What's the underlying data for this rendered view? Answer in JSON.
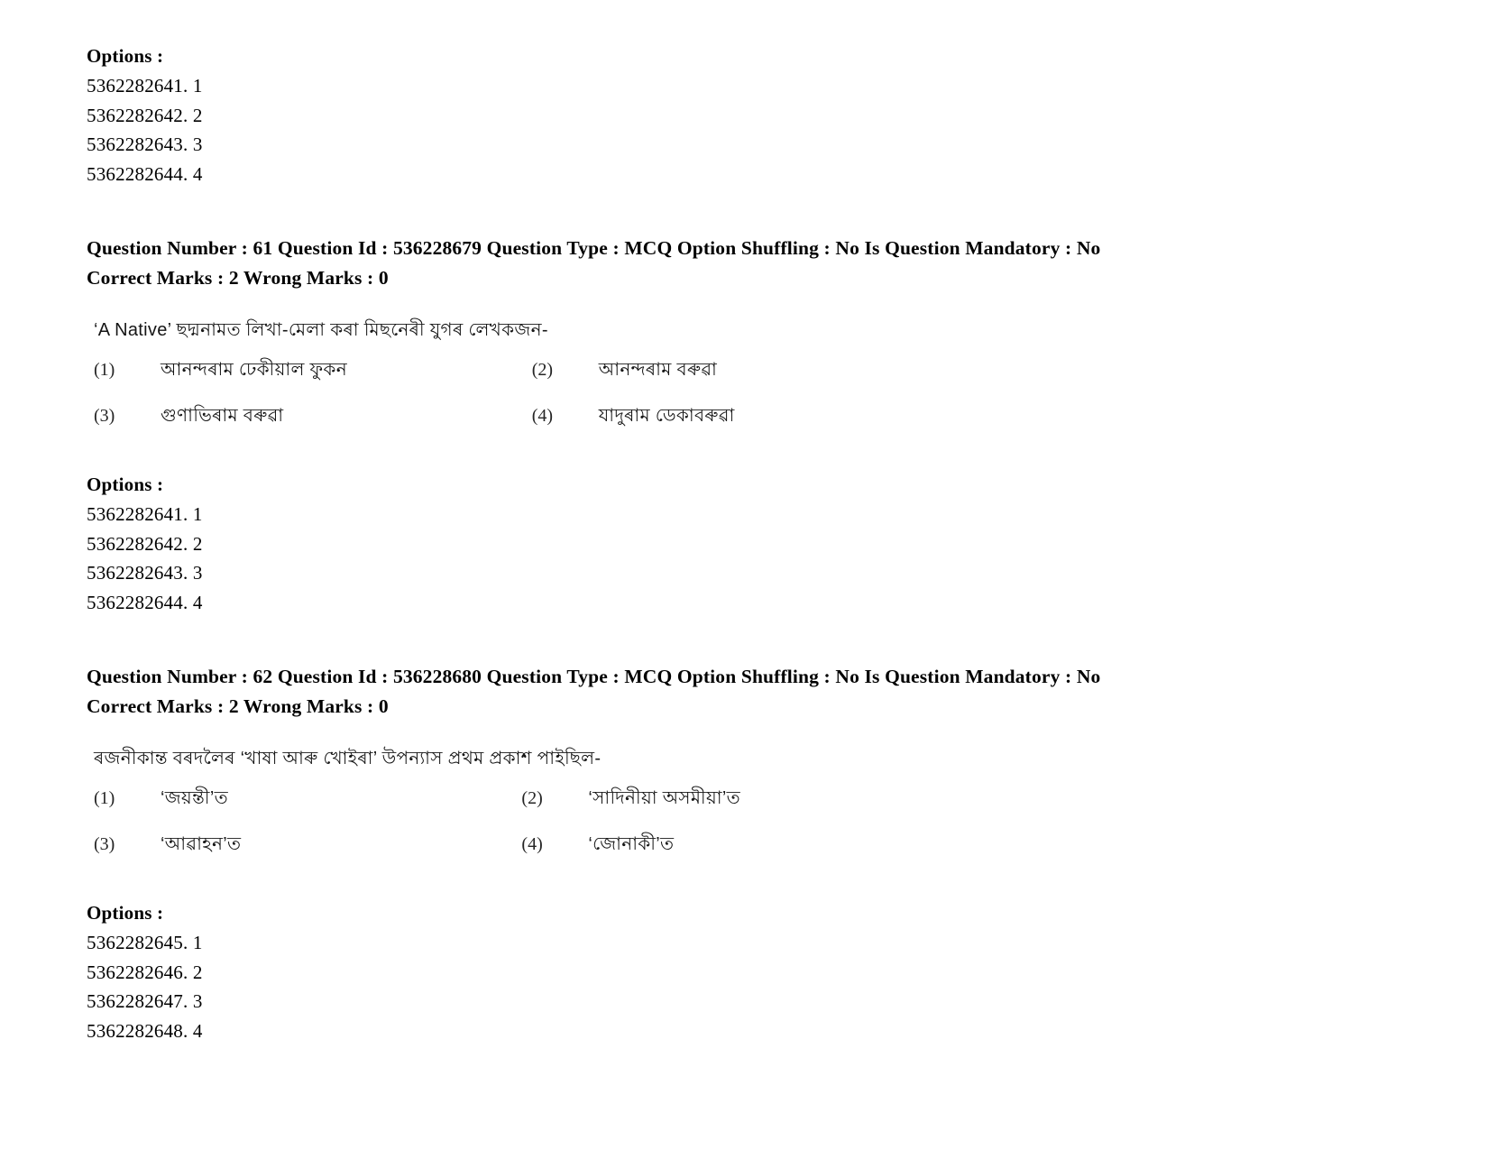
{
  "document": {
    "options_heading": "Options :",
    "blocks": [
      {
        "kind": "options",
        "heading": "Options :",
        "items": [
          {
            "id": "5362282641",
            "num": "1"
          },
          {
            "id": "5362282642",
            "num": "2"
          },
          {
            "id": "5362282643",
            "num": "3"
          },
          {
            "id": "5362282644",
            "num": "4"
          }
        ]
      }
    ]
  },
  "question61": {
    "header": {
      "question_number_label": "Question Number :",
      "question_number": "61",
      "question_id_label": "Question Id :",
      "question_id": "536228679",
      "question_type_label": "Question Type :",
      "question_type": "MCQ",
      "option_shuffling_label": "Option Shuffling :",
      "option_shuffling": "No",
      "is_mandatory_label": "Is Question Mandatory :",
      "is_mandatory": "No",
      "correct_marks_label": "Correct Marks :",
      "correct_marks": "2",
      "wrong_marks_label": "Wrong Marks :",
      "wrong_marks": "0"
    },
    "stem": "‘A Native’ ছদ্মনামত লিখা-মেলা কৰা মিছনেৰী যুগৰ লেখকজন-",
    "stem_latin": "‘A Native’",
    "choices": [
      {
        "marker": "(1)",
        "text": "আনন্দৰাম ঢেকীয়াল ফুকন"
      },
      {
        "marker": "(2)",
        "text": "আনন্দৰাম বৰুৱা"
      },
      {
        "marker": "(3)",
        "text": "গুণাভিৰাম বৰুৱা"
      },
      {
        "marker": "(4)",
        "text": "যাদুৰাম ডেকাবৰুৱা"
      }
    ],
    "options": {
      "heading": "Options :",
      "items": [
        {
          "id": "5362282641",
          "num": "1"
        },
        {
          "id": "5362282642",
          "num": "2"
        },
        {
          "id": "5362282643",
          "num": "3"
        },
        {
          "id": "5362282644",
          "num": "4"
        }
      ]
    }
  },
  "question62": {
    "header": {
      "question_number_label": "Question Number :",
      "question_number": "62",
      "question_id_label": "Question Id :",
      "question_id": "536228680",
      "question_type_label": "Question Type :",
      "question_type": "MCQ",
      "option_shuffling_label": "Option Shuffling :",
      "option_shuffling": "No",
      "is_mandatory_label": "Is Question Mandatory :",
      "is_mandatory": "No",
      "correct_marks_label": "Correct Marks :",
      "correct_marks": "2",
      "wrong_marks_label": "Wrong Marks :",
      "wrong_marks": "0"
    },
    "stem": "ৰজনীকান্ত বৰদলৈৰ ‘খাষা আৰু খোইৰা’ উপন্যাস প্ৰথম প্ৰকাশ পাইছিল-",
    "choices": [
      {
        "marker": "(1)",
        "text": "‘জয়ন্তী’ত"
      },
      {
        "marker": "(2)",
        "text": "‘সাদিনীয়া অসমীয়া’ত"
      },
      {
        "marker": "(3)",
        "text": "‘আৱাহন’ত"
      },
      {
        "marker": "(4)",
        "text": "‘জোনাকী’ত"
      }
    ],
    "options": {
      "heading": "Options :",
      "items": [
        {
          "id": "5362282645",
          "num": "1"
        },
        {
          "id": "5362282646",
          "num": "2"
        },
        {
          "id": "5362282647",
          "num": "3"
        },
        {
          "id": "5362282648",
          "num": "4"
        }
      ]
    }
  }
}
